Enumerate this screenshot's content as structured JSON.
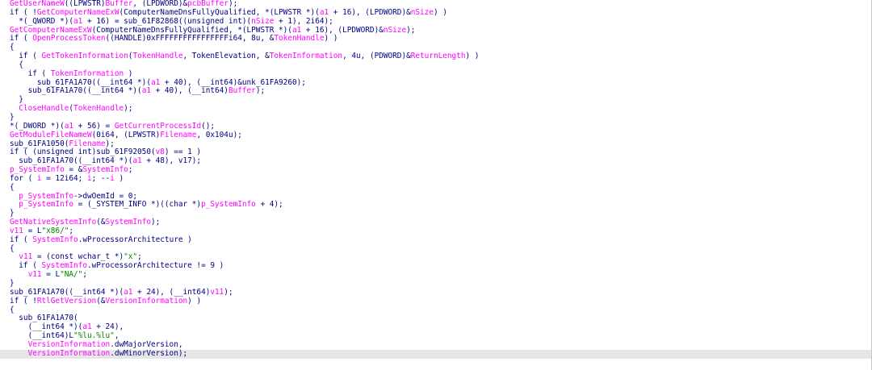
{
  "lines": [
    {
      "segs": [
        [
          "fn",
          "GetUserNameW"
        ],
        [
          "txt",
          "((LPWSTR)"
        ],
        [
          "fn",
          "Buffer"
        ],
        [
          "txt",
          ", (LPDWORD)&"
        ],
        [
          "fn",
          "pcbBuffer"
        ],
        [
          "txt",
          ");"
        ]
      ]
    },
    {
      "segs": [
        [
          "txt",
          "if ( !"
        ],
        [
          "fn",
          "GetComputerNameExW"
        ],
        [
          "txt",
          "(ComputerNameDnsFullyQualified, *(LPWSTR *)("
        ],
        [
          "fn",
          "a1"
        ],
        [
          "txt",
          " + 16), (LPDWORD)&"
        ],
        [
          "fn",
          "nSize"
        ],
        [
          "txt",
          ") )"
        ]
      ]
    },
    {
      "segs": [
        [
          "txt",
          "  *(_QWORD *)("
        ],
        [
          "fn",
          "a1"
        ],
        [
          "txt",
          " + 16) = sub_61F82868((unsigned int)("
        ],
        [
          "fn",
          "nSize"
        ],
        [
          "txt",
          " + 1), 2i64);"
        ]
      ]
    },
    {
      "segs": [
        [
          "fn",
          "GetComputerNameExW"
        ],
        [
          "txt",
          "(ComputerNameDnsFullyQualified, *(LPWSTR *)("
        ],
        [
          "fn",
          "a1"
        ],
        [
          "txt",
          " + 16), (LPDWORD)&"
        ],
        [
          "fn",
          "nSize"
        ],
        [
          "txt",
          ");"
        ]
      ]
    },
    {
      "segs": [
        [
          "txt",
          "if ( "
        ],
        [
          "fn",
          "OpenProcessToken"
        ],
        [
          "txt",
          "((HANDLE)0xFFFFFFFFFFFFFFFFi64, 8u, &"
        ],
        [
          "fn",
          "TokenHandle"
        ],
        [
          "txt",
          ") )"
        ]
      ]
    },
    {
      "segs": [
        [
          "txt",
          "{"
        ]
      ]
    },
    {
      "segs": [
        [
          "txt",
          "  if ( "
        ],
        [
          "fn",
          "GetTokenInformation"
        ],
        [
          "txt",
          "("
        ],
        [
          "fn",
          "TokenHandle"
        ],
        [
          "txt",
          ", TokenElevation, &"
        ],
        [
          "fn",
          "TokenInformation"
        ],
        [
          "txt",
          ", 4u, (PDWORD)&"
        ],
        [
          "fn",
          "ReturnLength"
        ],
        [
          "txt",
          ") )"
        ]
      ]
    },
    {
      "segs": [
        [
          "txt",
          "  {"
        ]
      ]
    },
    {
      "segs": [
        [
          "txt",
          "    if ( "
        ],
        [
          "fn",
          "TokenInformation"
        ],
        [
          "txt",
          " )"
        ]
      ]
    },
    {
      "segs": [
        [
          "txt",
          "      sub_61FA1A70((__int64 *)("
        ],
        [
          "fn",
          "a1"
        ],
        [
          "txt",
          " + 40), (__int64)&unk_61FA9260);"
        ]
      ]
    },
    {
      "segs": [
        [
          "txt",
          "    sub_61FA1A70((__int64 *)("
        ],
        [
          "fn",
          "a1"
        ],
        [
          "txt",
          " + 40), (__int64)"
        ],
        [
          "fn",
          "Buffer"
        ],
        [
          "txt",
          ");"
        ]
      ]
    },
    {
      "segs": [
        [
          "txt",
          "  }"
        ]
      ]
    },
    {
      "segs": [
        [
          "txt",
          "  "
        ],
        [
          "fn",
          "CloseHandle"
        ],
        [
          "txt",
          "("
        ],
        [
          "fn",
          "TokenHandle"
        ],
        [
          "txt",
          ");"
        ]
      ]
    },
    {
      "segs": [
        [
          "txt",
          "}"
        ]
      ]
    },
    {
      "segs": [
        [
          "txt",
          "*(_DWORD *)("
        ],
        [
          "fn",
          "a1"
        ],
        [
          "txt",
          " + 56) = "
        ],
        [
          "fn",
          "GetCurrentProcessId"
        ],
        [
          "txt",
          "();"
        ]
      ]
    },
    {
      "segs": [
        [
          "fn",
          "GetModuleFileNameW"
        ],
        [
          "txt",
          "(0i64, (LPWSTR)"
        ],
        [
          "fn",
          "Filename"
        ],
        [
          "txt",
          ", 0x104u);"
        ]
      ]
    },
    {
      "segs": [
        [
          "txt",
          "sub_61FA1050("
        ],
        [
          "fn",
          "Filename"
        ],
        [
          "txt",
          ");"
        ]
      ]
    },
    {
      "segs": [
        [
          "txt",
          "if ( (unsigned int)sub_61F92050("
        ],
        [
          "fn",
          "v8"
        ],
        [
          "txt",
          ") == 1 )"
        ]
      ]
    },
    {
      "segs": [
        [
          "txt",
          "  sub_61FA1A70((__int64 *)("
        ],
        [
          "fn",
          "a1"
        ],
        [
          "txt",
          " + 48), v17);"
        ]
      ]
    },
    {
      "segs": [
        [
          "fn",
          "p_SystemInfo"
        ],
        [
          "txt",
          " = &"
        ],
        [
          "fn",
          "SystemInfo"
        ],
        [
          "txt",
          ";"
        ]
      ]
    },
    {
      "segs": [
        [
          "txt",
          "for ( "
        ],
        [
          "fn",
          "i"
        ],
        [
          "txt",
          " = 12i64; "
        ],
        [
          "fn",
          "i"
        ],
        [
          "txt",
          "; --"
        ],
        [
          "fn",
          "i"
        ],
        [
          "txt",
          " )"
        ]
      ]
    },
    {
      "segs": [
        [
          "txt",
          "{"
        ]
      ]
    },
    {
      "segs": [
        [
          "txt",
          "  "
        ],
        [
          "fn",
          "p_SystemInfo"
        ],
        [
          "txt",
          "->dwOemId = 0;"
        ]
      ]
    },
    {
      "segs": [
        [
          "txt",
          "  "
        ],
        [
          "fn",
          "p_SystemInfo"
        ],
        [
          "txt",
          " = (_SYSTEM_INFO *)((char *)"
        ],
        [
          "fn",
          "p_SystemInfo"
        ],
        [
          "txt",
          " + 4);"
        ]
      ]
    },
    {
      "segs": [
        [
          "txt",
          "}"
        ]
      ]
    },
    {
      "segs": [
        [
          "fn",
          "GetNativeSystemInfo"
        ],
        [
          "txt",
          "(&"
        ],
        [
          "fn",
          "SystemInfo"
        ],
        [
          "txt",
          ");"
        ]
      ]
    },
    {
      "segs": [
        [
          "fn",
          "v11"
        ],
        [
          "txt",
          " = L"
        ],
        [
          "str",
          "\"x86/\""
        ],
        [
          "txt",
          ";"
        ]
      ]
    },
    {
      "segs": [
        [
          "txt",
          "if ( "
        ],
        [
          "fn",
          "SystemInfo"
        ],
        [
          "txt",
          ".wProcessorArchitecture )"
        ]
      ]
    },
    {
      "segs": [
        [
          "txt",
          "{"
        ]
      ]
    },
    {
      "segs": [
        [
          "txt",
          "  "
        ],
        [
          "fn",
          "v11"
        ],
        [
          "txt",
          " = (const wchar_t *)"
        ],
        [
          "str",
          "\"x\""
        ],
        [
          "txt",
          ";"
        ]
      ]
    },
    {
      "segs": [
        [
          "txt",
          "  if ( "
        ],
        [
          "fn",
          "SystemInfo"
        ],
        [
          "txt",
          ".wProcessorArchitecture != 9 )"
        ]
      ]
    },
    {
      "segs": [
        [
          "txt",
          "    "
        ],
        [
          "fn",
          "v11"
        ],
        [
          "txt",
          " = L"
        ],
        [
          "str",
          "\"NA/\""
        ],
        [
          "txt",
          ";"
        ]
      ]
    },
    {
      "segs": [
        [
          "txt",
          "}"
        ]
      ]
    },
    {
      "segs": [
        [
          "txt",
          "sub_61FA1A70((__int64 *)("
        ],
        [
          "fn",
          "a1"
        ],
        [
          "txt",
          " + 24), (__int64)"
        ],
        [
          "fn",
          "v11"
        ],
        [
          "txt",
          ");"
        ]
      ]
    },
    {
      "segs": [
        [
          "txt",
          "if ( !"
        ],
        [
          "fn",
          "RtlGetVersion"
        ],
        [
          "txt",
          "(&"
        ],
        [
          "fn",
          "VersionInformation"
        ],
        [
          "txt",
          ") )"
        ]
      ]
    },
    {
      "segs": [
        [
          "txt",
          "{"
        ]
      ]
    },
    {
      "segs": [
        [
          "txt",
          "  sub_61FA1A70("
        ]
      ]
    },
    {
      "segs": [
        [
          "txt",
          "    (__int64 *)("
        ],
        [
          "fn",
          "a1"
        ],
        [
          "txt",
          " + 24),"
        ]
      ]
    },
    {
      "segs": [
        [
          "txt",
          "    (__int64)L"
        ],
        [
          "str",
          "\"%lu.%lu\""
        ],
        [
          "txt",
          ","
        ]
      ]
    },
    {
      "segs": [
        [
          "txt",
          "    "
        ],
        [
          "fn",
          "VersionInformation"
        ],
        [
          "txt",
          ".dwMajorVersion,"
        ]
      ]
    },
    {
      "segs": [
        [
          "txt",
          "    "
        ],
        [
          "fn",
          "VersionInformation"
        ],
        [
          "txt",
          ".dwMinorVersion);"
        ]
      ],
      "highlight": true
    }
  ],
  "colors": {
    "background": "#ffffff",
    "text": "#000080",
    "identifier": "#ff00ff",
    "string": "#008000",
    "current_line": "#e6e6e6"
  }
}
